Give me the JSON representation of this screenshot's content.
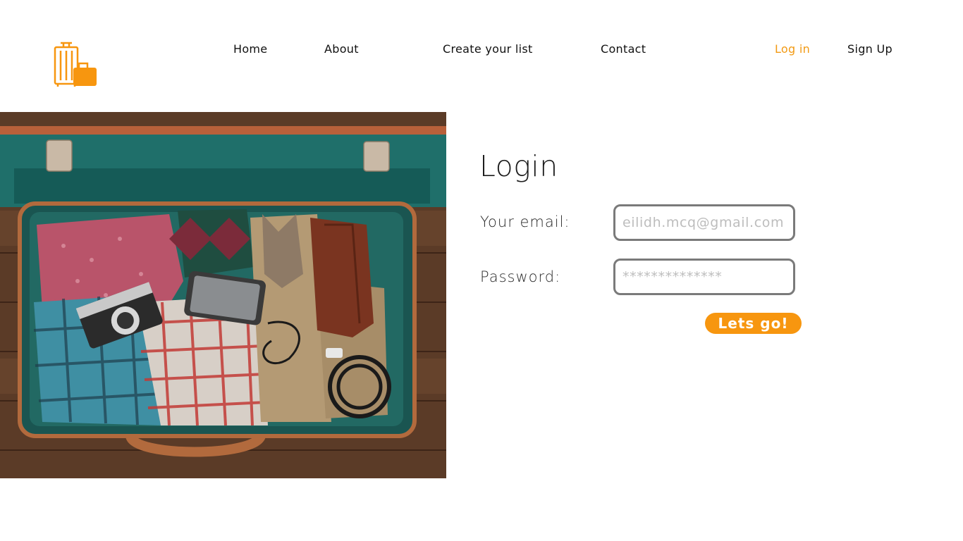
{
  "brand": {
    "logo": "luggage-icon",
    "accent_color": "#f7960f"
  },
  "nav": {
    "home": "Home",
    "about": "About",
    "create_list": "Create your list",
    "contact": "Contact",
    "login": "Log in",
    "signup": "Sign Up"
  },
  "hero": {
    "image": "open-suitcase-photo"
  },
  "login": {
    "title": "Login",
    "email_label": "Your email:",
    "email_placeholder": "eilidh.mcq@gmail.com",
    "password_label": "Password:",
    "password_placeholder": "**************",
    "submit_label": "Lets go!"
  }
}
